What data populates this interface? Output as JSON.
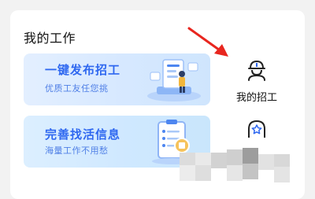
{
  "section": {
    "title": "我的工作"
  },
  "banners": [
    {
      "title": "一键发布招工",
      "subtitle": "优质工友任您挑",
      "icon": "job-board-illustration"
    },
    {
      "title": "完善找活信息",
      "subtitle": "海量工作不用愁",
      "icon": "clipboard-illustration"
    }
  ],
  "side_items": [
    {
      "label": "我的招工",
      "icon": "worker-helmet-icon"
    },
    {
      "label": "",
      "icon": "star-badge-icon"
    }
  ],
  "annotation": {
    "arrow_color": "#e8261f"
  },
  "colors": {
    "accent": "#2f68f0",
    "card_bg": "#ffffff",
    "page_bg": "#f2f2f2"
  }
}
